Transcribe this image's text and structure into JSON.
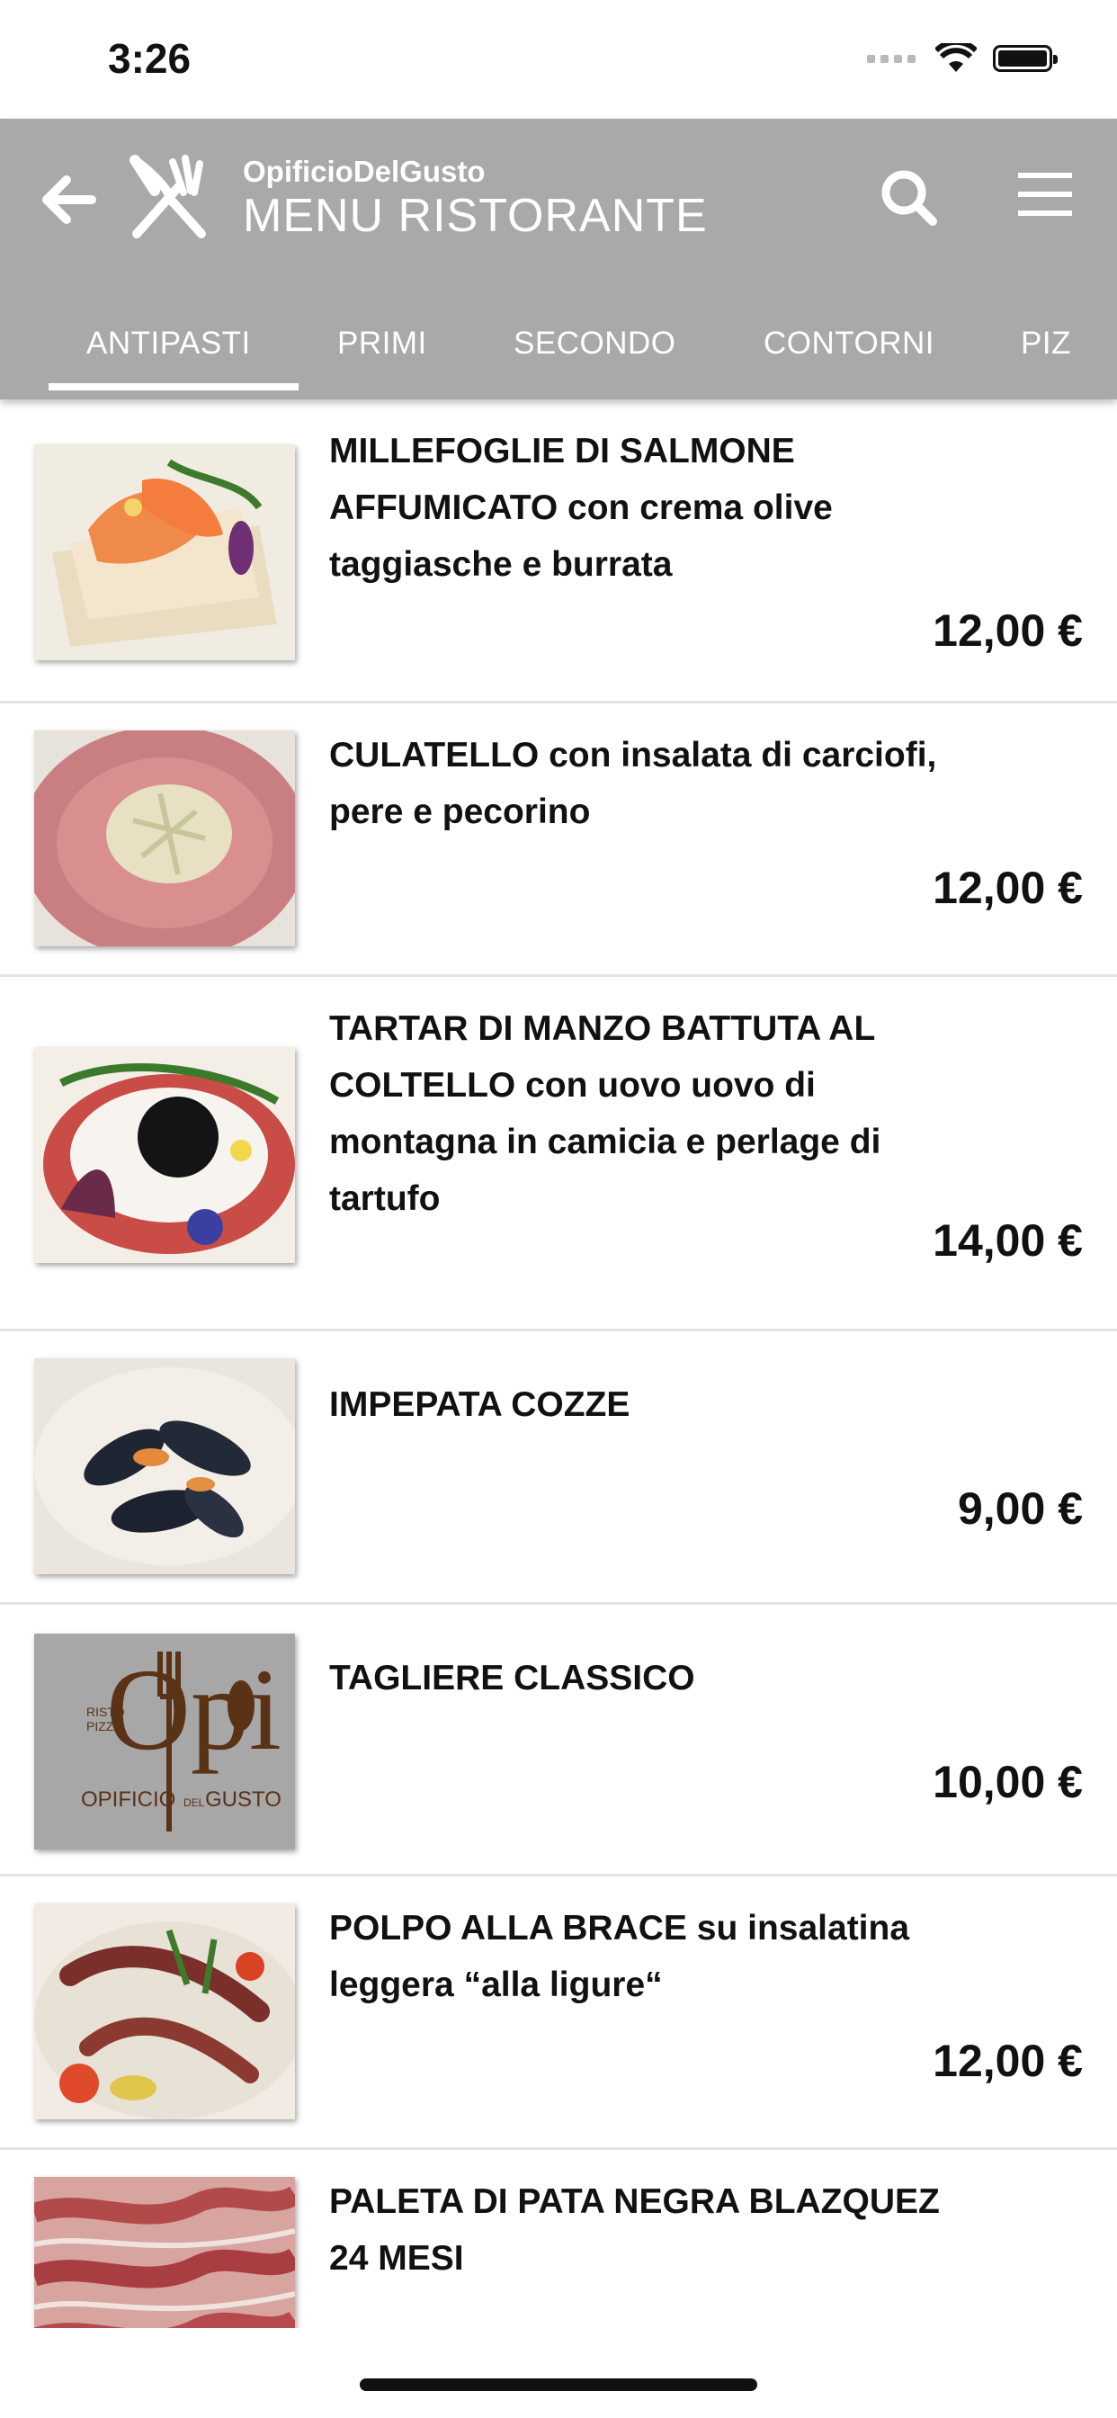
{
  "status_bar": {
    "time": "3:26"
  },
  "header": {
    "brand": "OpificioDelGusto",
    "title": "MENU RISTORANTE",
    "icons": [
      "back-arrow-icon",
      "cutlery-icon",
      "search-icon",
      "hamburger-menu-icon"
    ]
  },
  "tabs": [
    {
      "label": "ANTIPASTI",
      "selected": true
    },
    {
      "label": "PRIMI",
      "selected": false
    },
    {
      "label": "SECONDO",
      "selected": false
    },
    {
      "label": "CONTORNI",
      "selected": false
    },
    {
      "label": "PIZ",
      "selected": false
    }
  ],
  "menu_items": [
    {
      "name": "MILLEFOGLIE DI SALMONE AFFUMICATO con crema olive taggiasche e burrata",
      "price": "12,00 €"
    },
    {
      "name": "CULATELLO con insalata di carciofi, pere e pecorino",
      "price": "12,00 €"
    },
    {
      "name": "TARTAR DI MANZO BATTUTA AL COLTELLO con uovo uovo di montagna in camicia e perlage di tartufo",
      "price": "14,00 €"
    },
    {
      "name": "IMPEPATA COZZE",
      "price": "9,00 €"
    },
    {
      "name": "TAGLIERE CLASSICO",
      "price": "10,00 €"
    },
    {
      "name": "POLPO ALLA BRACE su insalatina leggera “alla ligure“",
      "price": "12,00 €"
    },
    {
      "name": "PALETA DI PATA NEGRA BLAZQUEZ 24 MESI",
      "price": ""
    }
  ],
  "logo_text": {
    "risto": "RISTO",
    "pizza": "PIZZA",
    "opi": "Opi",
    "opificio": "OPIFICIO",
    "del": "DEL",
    "gusto": "GUSTO"
  },
  "colors": {
    "app_bar": "#a9a9a9",
    "accent_text": "#ffffff"
  }
}
